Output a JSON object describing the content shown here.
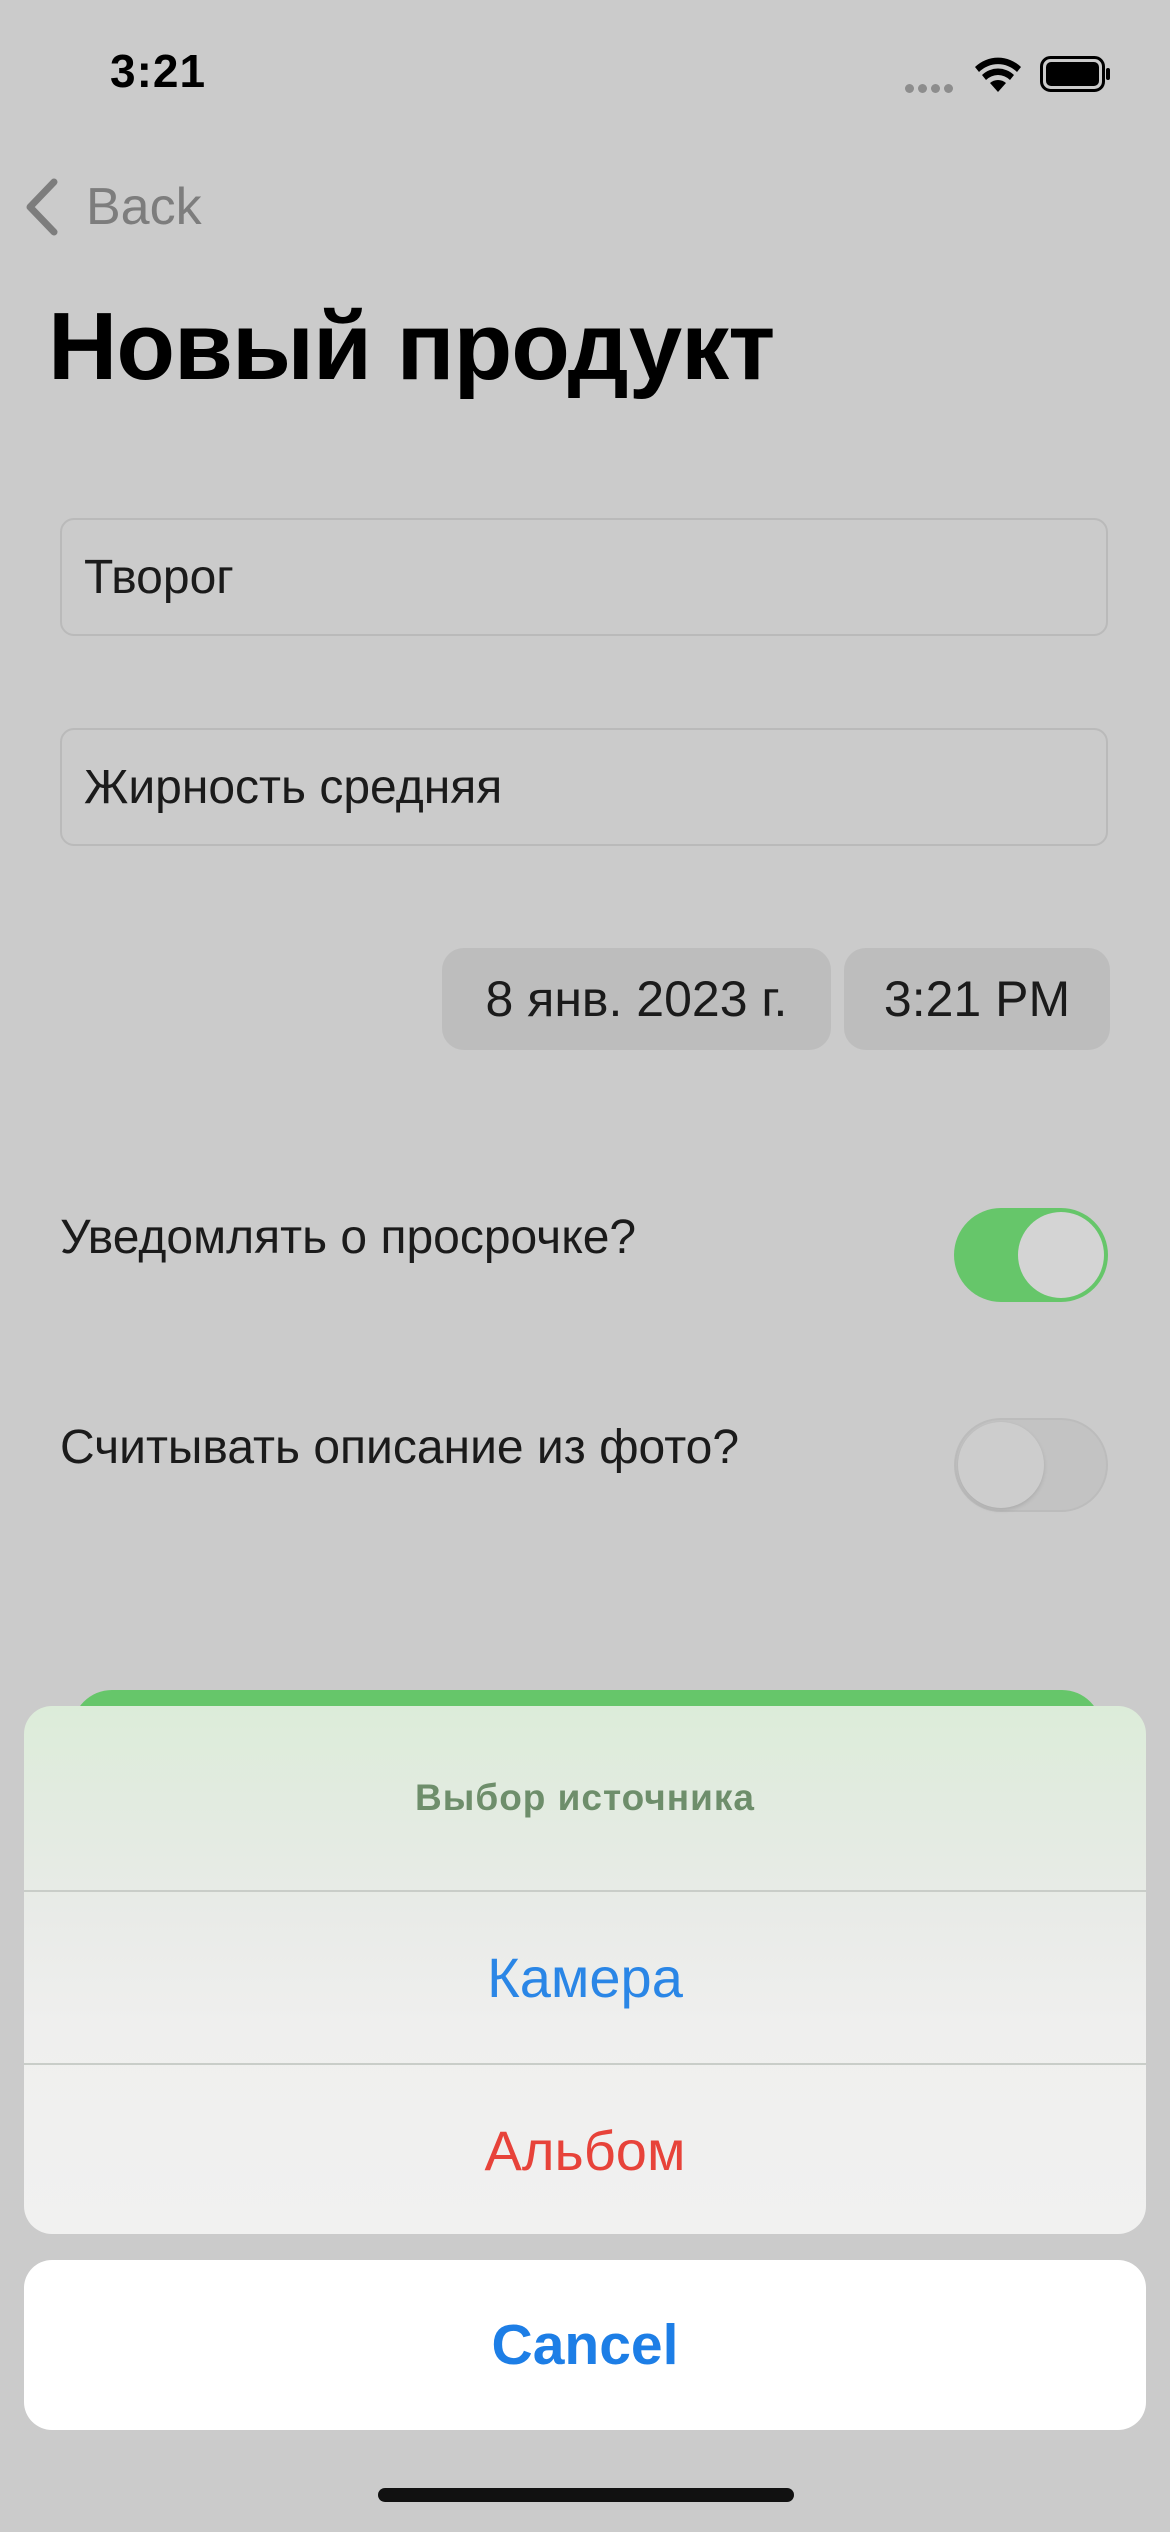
{
  "status_bar": {
    "time": "3:21"
  },
  "nav": {
    "back_label": "Back"
  },
  "page": {
    "title": "Новый продукт"
  },
  "form": {
    "name_value": "Творог",
    "description_value": "Жирность средняя",
    "date_value": "8 янв. 2023 г.",
    "time_value": "3:21 PM",
    "notify_label": "Уведомлять о просрочке?",
    "notify_on": true,
    "read_photo_label": "Считывать описание из фото?",
    "read_photo_on": false
  },
  "action_sheet": {
    "title": "Выбор источника",
    "options": [
      "Камера",
      "Альбом"
    ],
    "cancel_label": "Cancel"
  },
  "colors": {
    "accent_green": "#66c66a",
    "option_blue": "#2a86e6",
    "option_red": "#e7433a"
  }
}
